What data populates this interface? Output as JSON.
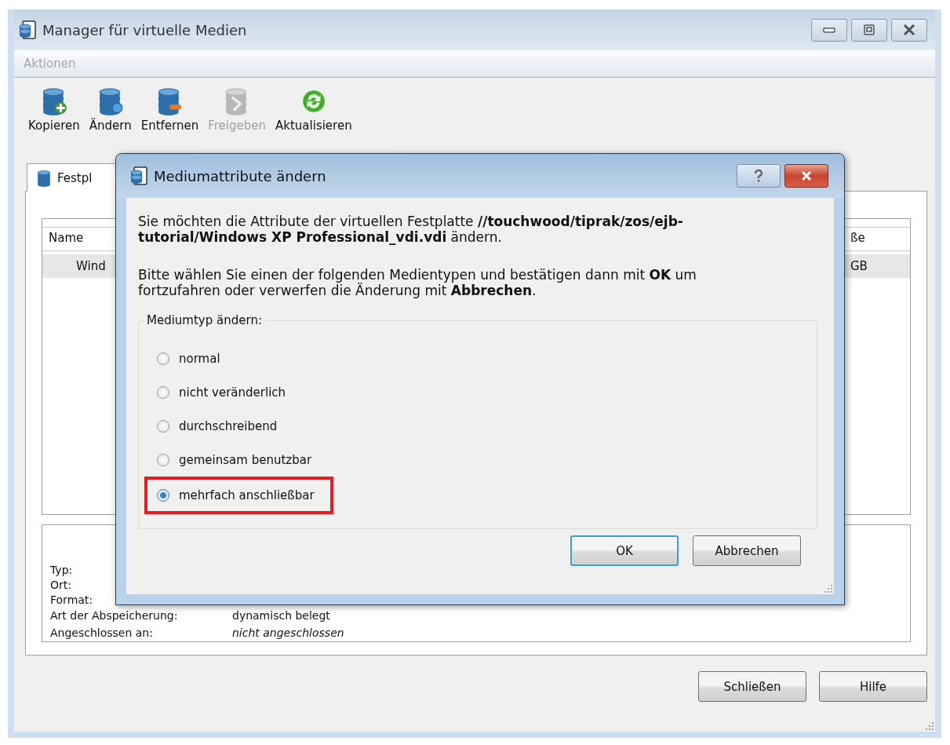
{
  "window": {
    "title": "Manager für virtuelle Medien"
  },
  "menu": [
    {
      "label": "Aktionen",
      "disabled": true
    }
  ],
  "toolbar": [
    {
      "label": "Kopieren",
      "disabled": false
    },
    {
      "label": "Ändern",
      "disabled": false
    },
    {
      "label": "Entfernen",
      "disabled": false
    },
    {
      "label": "Freigeben",
      "disabled": true
    },
    {
      "label": "Aktualisieren",
      "disabled": false
    }
  ],
  "tabs": [
    {
      "label": "Festpl",
      "selected": true
    }
  ],
  "table": {
    "columns": [
      "Name",
      "ße"
    ],
    "rows": [
      {
        "cells": [
          "Wind",
          "GB"
        ],
        "selected": true
      }
    ]
  },
  "details": [
    {
      "label": "Typ:"
    },
    {
      "label": "Ort:"
    },
    {
      "label": "Format:"
    },
    {
      "label": "Art der Abspeicherung:",
      "value": "dynamisch belegt",
      "italic": false
    },
    {
      "label": "Angeschlossen an:",
      "value": "nicht angeschlossen",
      "italic": true
    }
  ],
  "buttons": [
    "Schließen",
    "Hilfe"
  ],
  "dialog": {
    "title": "Mediumattribute ändern",
    "message": "Sie möchten die Attribute der virtuellen Festplatte **//touchwood/tiprak/zos/ejb-tutorial/Windows XP Professional_vdi.vdi** ändern.",
    "instruction": "Bitte wählen Sie einen der folgenden Medientypen und bestätigen dann mit **OK** um fortzufahren oder verwerfen die Änderung mit **Abbrechen**.",
    "group_title": "Mediumtyp ändern:",
    "options": [
      {
        "label": "normal",
        "selected": false,
        "highlighted": false
      },
      {
        "label": "nicht veränderlich",
        "selected": false,
        "highlighted": false
      },
      {
        "label": "durchschreibend",
        "selected": false,
        "highlighted": false
      },
      {
        "label": "gemeinsam benutzbar",
        "selected": false,
        "highlighted": false
      },
      {
        "label": "mehrfach anschließbar",
        "selected": true,
        "highlighted": true
      }
    ],
    "buttons": [
      {
        "label": "OK",
        "default": true
      },
      {
        "label": "Abbrechen",
        "default": false
      }
    ]
  }
}
